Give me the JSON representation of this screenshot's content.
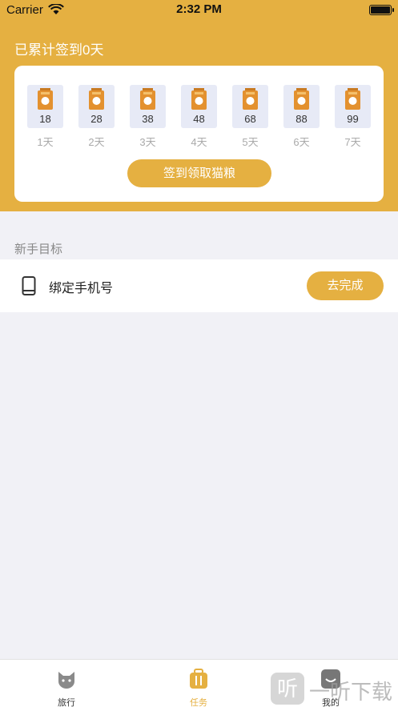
{
  "status_bar": {
    "carrier": "Carrier",
    "time": "2:32 PM"
  },
  "header": {
    "title": "已累计签到0天"
  },
  "sign_in": {
    "days": [
      {
        "count": "18",
        "label": "1天"
      },
      {
        "count": "28",
        "label": "2天"
      },
      {
        "count": "38",
        "label": "3天"
      },
      {
        "count": "48",
        "label": "4天"
      },
      {
        "count": "68",
        "label": "5天"
      },
      {
        "count": "88",
        "label": "6天"
      },
      {
        "count": "99",
        "label": "7天"
      }
    ],
    "button": "签到领取猫粮"
  },
  "newbie_tasks": {
    "section_title": "新手目标",
    "items": [
      {
        "label": "绑定手机号",
        "button": "去完成",
        "icon": "phone-icon"
      }
    ]
  },
  "tabbar": {
    "tabs": [
      {
        "label": "旅行",
        "icon": "cat-icon"
      },
      {
        "label": "任务",
        "icon": "luggage-icon",
        "active": true
      },
      {
        "label": "我的",
        "icon": "profile-icon"
      }
    ]
  },
  "watermark": {
    "badge": "听",
    "text": "一听下载"
  },
  "colors": {
    "accent": "#e5b041",
    "background": "#f1f1f6",
    "bag_box": "#e7eaf6"
  }
}
